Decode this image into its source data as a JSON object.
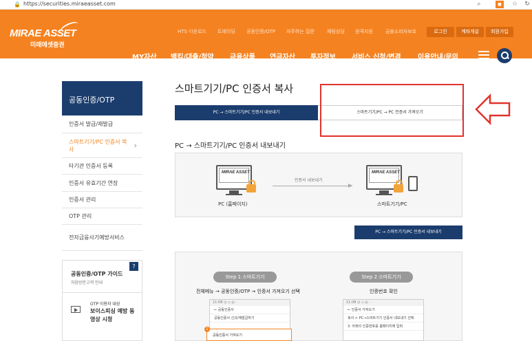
{
  "browser": {
    "url": "https://securities.miraeasset.com"
  },
  "header": {
    "logo_en": "MIRAE ASSET",
    "logo_ko": "미래에셋증권",
    "top_links": [
      "HTS 다운로드",
      "트레이딩",
      "공동인증/OTP",
      "자주하는 질문",
      "채팅상담",
      "원격지원",
      "금융소비자보호"
    ],
    "top_buttons": [
      "로그인",
      "계좌개설",
      "회원가입"
    ],
    "nav": [
      "MY자산",
      "뱅킹/대출/청약",
      "금융상품",
      "연금자산",
      "투자정보",
      "서비스 신청/변경",
      "이용안내/문의"
    ]
  },
  "sidebar": {
    "title": "공동인증/OTP",
    "items": [
      {
        "label": "인증서 발급/재발급"
      },
      {
        "label": "스마트기기/PC 인증서 복사"
      },
      {
        "label": "타기관 인증서 등록"
      },
      {
        "label": "인증서 유효기간 연장"
      },
      {
        "label": "인증서 관리"
      },
      {
        "label": "OTP 관리"
      },
      {
        "label": "전자금융사기예방서비스"
      }
    ]
  },
  "guide": {
    "title": "공동인증/OTP 가이드",
    "subtitle": "처음방문고객 안내",
    "badge": "?",
    "video_top": "OTP 이용자 대상",
    "video_title": "보이스피싱 예방 동영상 시청"
  },
  "main": {
    "title": "스마트기기/PC 인증서 복사",
    "tab_export": "PC → 스마트기기/PC 인증서 내보내기",
    "tab_import": "스마트기기/PC → PC 인증서 가져오기",
    "section_title": "PC → 스마트기기/PC 인증서 내보내기",
    "diagram": {
      "left_brand": "MIRAE ASSET",
      "right_brand": "MIRAE ASSET",
      "left_label": "PC (홈페이지)",
      "arrow_label": "인증서 내보내기",
      "right_label": "스마트기기/PC"
    },
    "export_button": "PC → 스마트기기/PC 인증서 내보내기",
    "steps": [
      {
        "pill": "Step 1  스마트기기",
        "text": "전체메뉴 → 공동인증/OTP → 인증서 가져오기 선택",
        "mock_header": "11:08 ◷ ◇ ◎ ·",
        "mock_lines": [
          "← 공동인증서",
          "공동인증서 신규/재발급하기",
          "공동인증서 가져오기"
        ]
      },
      {
        "pill": "Step 2  스마트기기",
        "text": "인증번호 확인",
        "mock_header": "11:08 ◷ ◇ ◎ ·",
        "mock_lines": [
          "← 인증서 가져오기",
          "복사 > PC→스마트기기 인증서 내보내기 선택",
          "3. 아래의 인증번호를 홈페이지에 입력"
        ]
      }
    ],
    "highlight_num": "1"
  },
  "colors": {
    "brand_orange": "#f58220",
    "brand_navy": "#1b3d6e",
    "annotation_red": "#e0322c"
  }
}
